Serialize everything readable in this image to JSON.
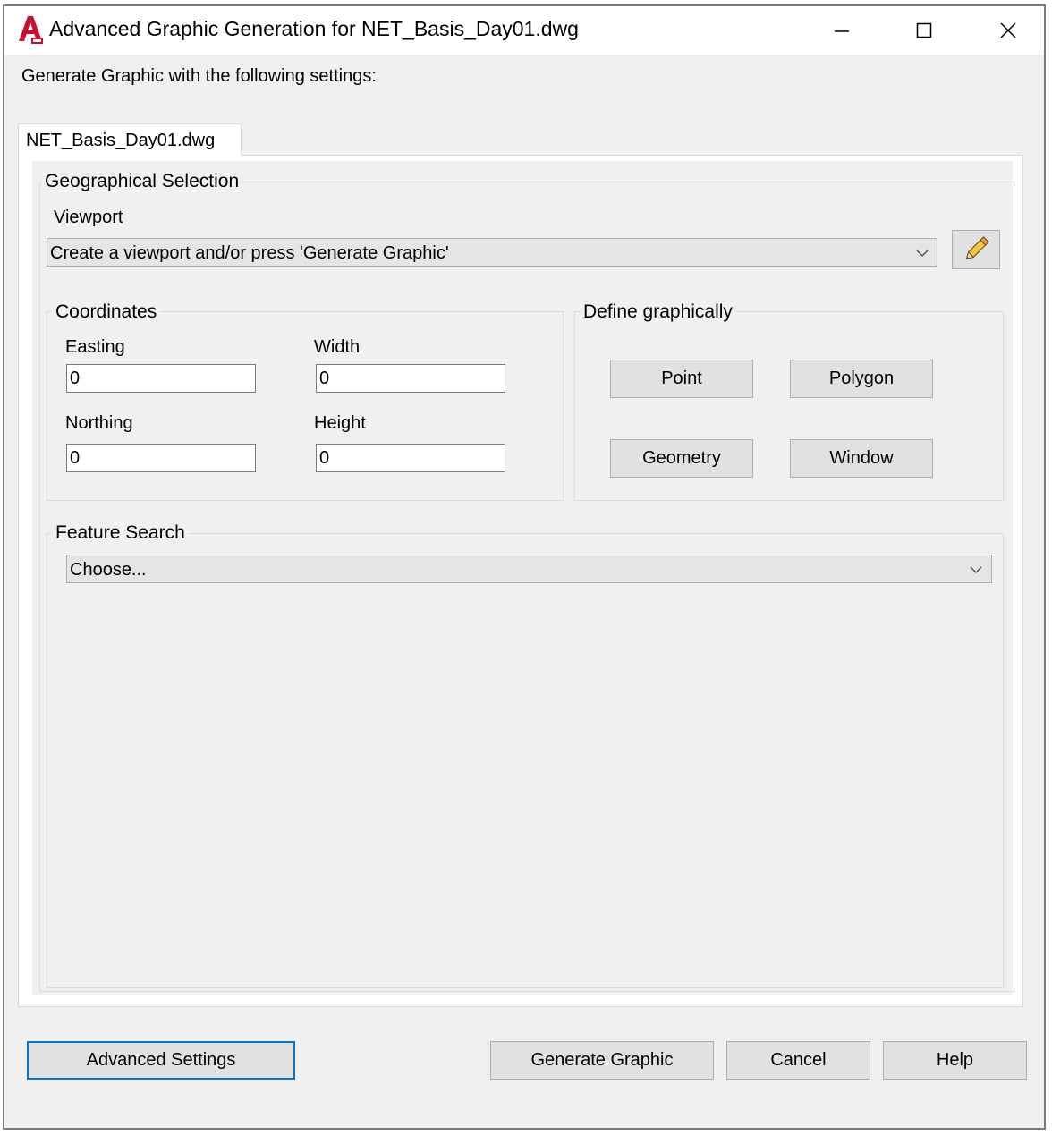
{
  "window": {
    "title": "Advanced Graphic Generation for NET_Basis_Day01.dwg",
    "app_icon": "autocad-map-icon",
    "controls": [
      "minimize-icon",
      "maximize-icon",
      "close-icon"
    ]
  },
  "intro_label": "Generate Graphic with the following settings:",
  "tab": {
    "label": "NET_Basis_Day01.dwg"
  },
  "geo_selection": {
    "legend": "Geographical Selection",
    "viewport_label": "Viewport",
    "viewport_value": "Create a viewport and/or press 'Generate Graphic'",
    "pencil_icon": "pencil-icon"
  },
  "coordinates": {
    "legend": "Coordinates",
    "easting_label": "Easting",
    "easting_value": "0",
    "width_label": "Width",
    "width_value": "0",
    "northing_label": "Northing",
    "northing_value": "0",
    "height_label": "Height",
    "height_value": "0"
  },
  "define_graphically": {
    "legend": "Define graphically",
    "point": "Point",
    "polygon": "Polygon",
    "geometry": "Geometry",
    "window": "Window"
  },
  "feature_search": {
    "legend": "Feature Search",
    "value": "Choose..."
  },
  "footer": {
    "advanced_settings": "Advanced Settings",
    "generate_graphic": "Generate Graphic",
    "cancel": "Cancel",
    "help": "Help"
  },
  "colors": {
    "dialog_bg": "#f0f0f0",
    "button_bg": "#e1e1e1",
    "focus_border": "#0078d7",
    "icon_red": "#c8102e"
  }
}
